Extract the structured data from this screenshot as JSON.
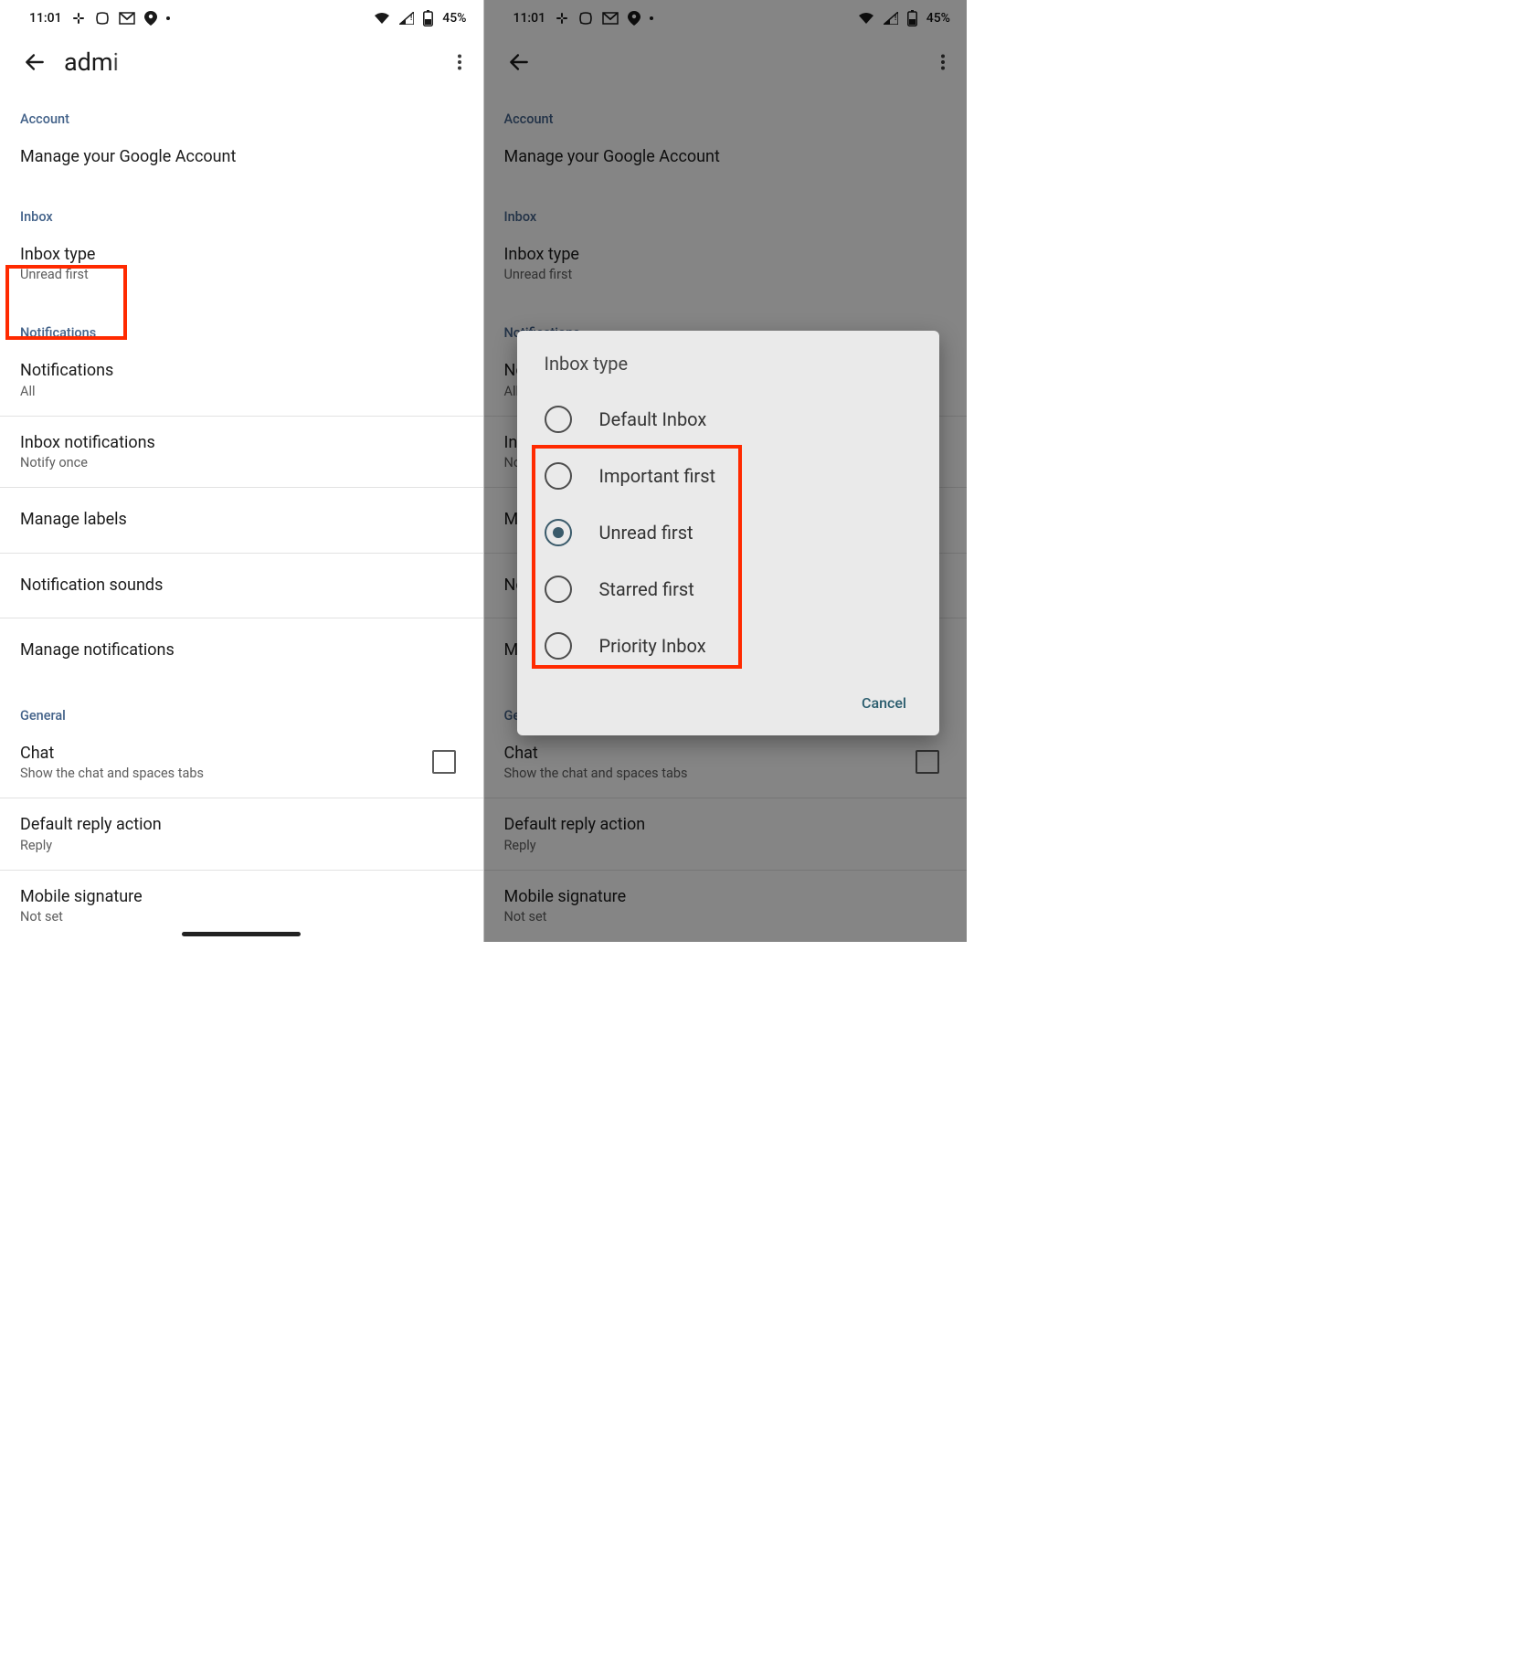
{
  "status": {
    "time": "11:01",
    "battery_text": "45%"
  },
  "appbar": {
    "title_prefix": "adm",
    "title_fade": "i"
  },
  "sections": {
    "account": {
      "header": "Account",
      "manage": "Manage your Google Account"
    },
    "inbox": {
      "header": "Inbox",
      "inbox_type_title": "Inbox type",
      "inbox_type_value": "Unread first"
    },
    "notifications": {
      "header": "Notifications",
      "notifications_title": "Notifications",
      "notifications_value": "All",
      "inbox_notif_title": "Inbox notifications",
      "inbox_notif_value": "Notify once",
      "manage_labels": "Manage labels",
      "notif_sounds": "Notification sounds",
      "manage_notifications": "Manage notifications"
    },
    "general": {
      "header": "General",
      "chat_title": "Chat",
      "chat_sub": "Show the chat and spaces tabs",
      "reply_title": "Default reply action",
      "reply_value": "Reply",
      "sig_title": "Mobile signature",
      "sig_value": "Not set"
    }
  },
  "dialog": {
    "title": "Inbox type",
    "options": [
      "Default Inbox",
      "Important first",
      "Unread first",
      "Starred first",
      "Priority Inbox"
    ],
    "selected_index": 2,
    "cancel": "Cancel"
  }
}
